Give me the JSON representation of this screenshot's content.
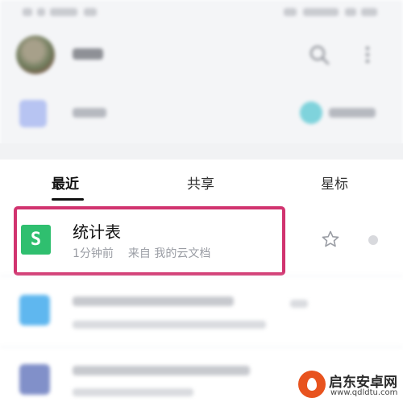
{
  "tabs": {
    "recent": "最近",
    "shared": "共享",
    "starred": "星标"
  },
  "file": {
    "name": "统计表",
    "icon_letter": "S",
    "time": "1分钟前",
    "source_prefix": "来自",
    "source": "我的云文档"
  },
  "watermark": {
    "title": "启东安卓网",
    "url": "www.qdldtu.com"
  },
  "colors": {
    "highlight": "#d1336f",
    "sheet_icon": "#2fbf6f"
  }
}
